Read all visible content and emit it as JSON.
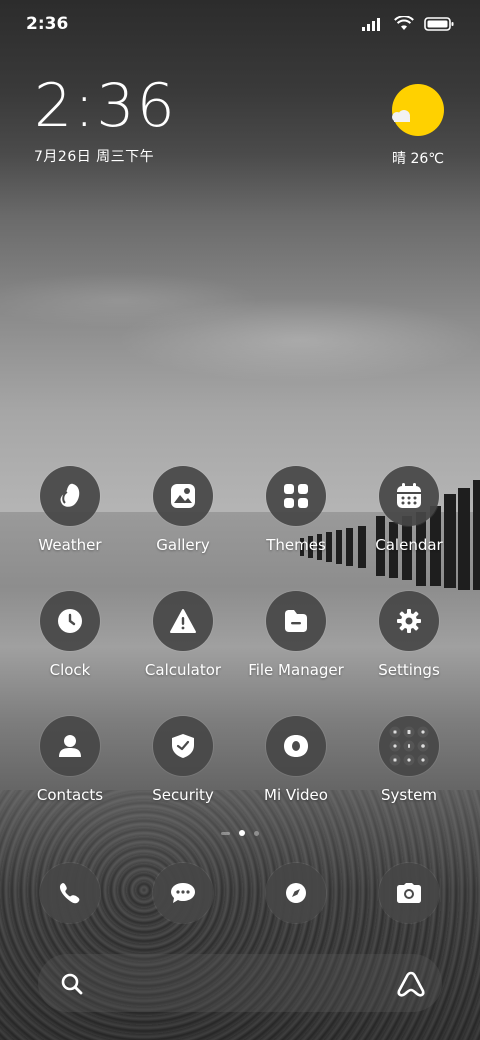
{
  "status_bar": {
    "time": "2:36"
  },
  "clock_widget": {
    "time": "2:36",
    "date": "7月26日 周三下午"
  },
  "weather_widget": {
    "condition": "晴",
    "temperature": "26℃",
    "text": "晴 26℃",
    "sun_color": "#FFD100",
    "icon": "sunny-partly-cloudy-icon"
  },
  "apps": [
    {
      "label": "Weather",
      "icon": "weather-icon"
    },
    {
      "label": "Gallery",
      "icon": "gallery-icon"
    },
    {
      "label": "Themes",
      "icon": "themes-icon"
    },
    {
      "label": "Calendar",
      "icon": "calendar-icon"
    },
    {
      "label": "Clock",
      "icon": "clock-icon"
    },
    {
      "label": "Calculator",
      "icon": "calculator-icon"
    },
    {
      "label": "File Manager",
      "icon": "file-manager-icon"
    },
    {
      "label": "Settings",
      "icon": "settings-icon"
    },
    {
      "label": "Contacts",
      "icon": "contacts-icon"
    },
    {
      "label": "Security",
      "icon": "security-icon"
    },
    {
      "label": "Mi Video",
      "icon": "mi-video-icon"
    },
    {
      "label": "System",
      "icon": "system-folder-icon"
    }
  ],
  "page_indicator": {
    "pages": 3,
    "current": 2
  },
  "dock": [
    {
      "icon": "phone-icon"
    },
    {
      "icon": "messages-icon"
    },
    {
      "icon": "browser-icon"
    },
    {
      "icon": "camera-icon"
    }
  ],
  "search_bar": {
    "left_icon": "search-icon",
    "right_icon": "assistant-icon"
  }
}
